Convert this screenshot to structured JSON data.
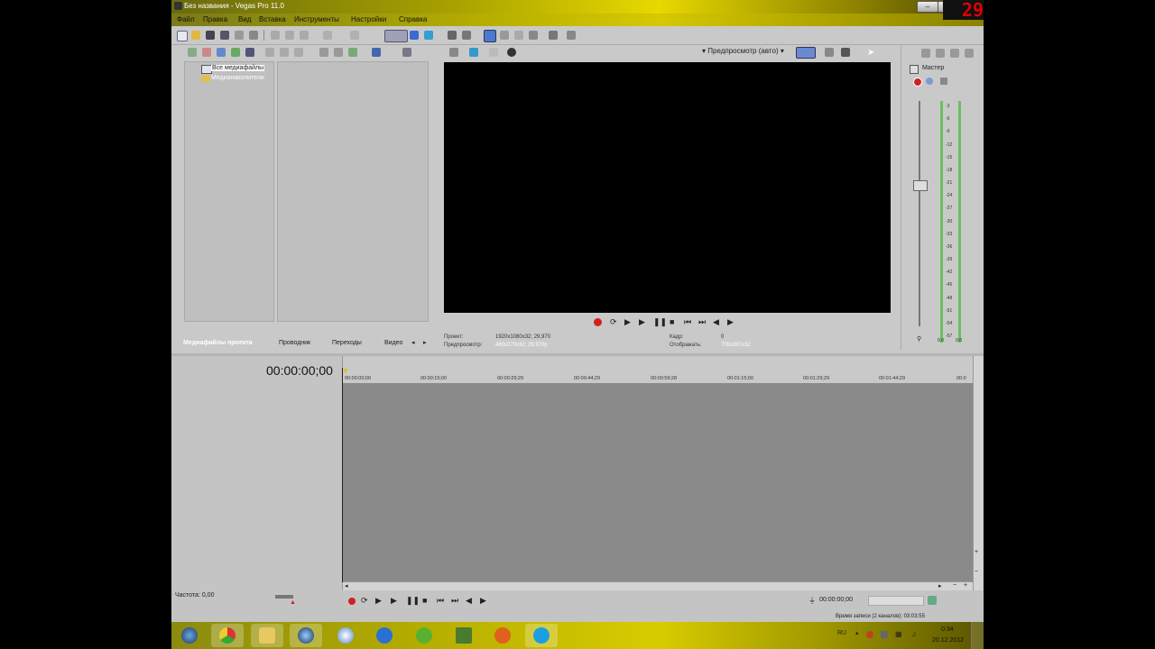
{
  "window": {
    "title": "Без названия - Vegas Pro 11.0",
    "buttons": [
      "–",
      "□",
      "×"
    ]
  },
  "overlay_counter": "29",
  "menu": [
    "Файл",
    "Правка",
    "Вид",
    "Вставка",
    "Инструменты",
    "Настройки",
    "Справка"
  ],
  "explorer": {
    "tree": [
      "Все медиафайлы",
      "Медианакопители"
    ],
    "tabs": [
      "Медиафайлы проекта",
      "Проводник",
      "Переходы",
      "Видео"
    ]
  },
  "preview": {
    "mode_label": "Предпросмотр (авто)",
    "info": {
      "project_label": "Проект:",
      "project_value": "1920x1080x32; 29,970",
      "preview_label": "Предпросмотр:",
      "preview_value": "480x270x32; 29,970p",
      "frame_label": "Кадр:",
      "frame_value": "0",
      "display_label": "Отображать:",
      "display_value": "705x397x32"
    }
  },
  "master": {
    "label": "Мастер",
    "scale": [
      "3",
      "6",
      "9",
      "12",
      "15",
      "18",
      "21",
      "24",
      "27",
      "30",
      "33",
      "36",
      "39",
      "42",
      "45",
      "48",
      "51",
      "54",
      "57"
    ],
    "bottom_values": [
      "0.0",
      "0.0"
    ]
  },
  "timeline": {
    "timecode": "00:00:00;00",
    "ruler": [
      "00:00:00;00",
      "00:00:15;00",
      "00:00:29;29",
      "00:00:44;29",
      "00:00:59;28",
      "00:01:15;00",
      "00:01:29;29",
      "00:01:44;29",
      "00:0"
    ],
    "rate_label": "Частота: 0,00",
    "end_time": "00:00:00;00"
  },
  "status": {
    "record_time": "Время записи (2 каналов): 03:03:55"
  },
  "taskbar": {
    "lang": "RU",
    "time": "0:34",
    "date": "20.12.2012",
    "apps": [
      "start",
      "chrome",
      "explorer",
      "media-player",
      "itunes",
      "thunder",
      "utorrent",
      "minecraft",
      "browser-orange",
      "skype"
    ]
  },
  "colors": {
    "title_yellow": "#d6c800",
    "panel_gray": "#c9c9c9",
    "timeline_gray": "#8a8a8a",
    "record_red": "#d02020",
    "meter_green": "#6ac060"
  }
}
